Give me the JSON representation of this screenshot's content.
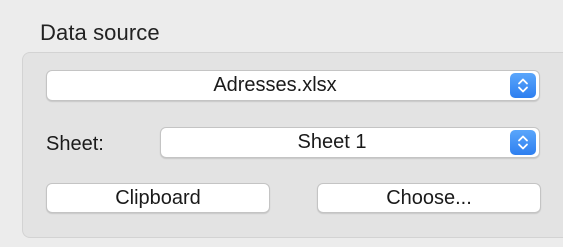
{
  "group": {
    "title": "Data source"
  },
  "file_popup": {
    "value": "Adresses.xlsx"
  },
  "sheet": {
    "label": "Sheet:",
    "value": "Sheet 1"
  },
  "buttons": {
    "clipboard_label": "Clipboard",
    "choose_label": "Choose..."
  },
  "colors": {
    "accent": "#3b8bf6",
    "panel": "#e3e3e3",
    "window": "#ececec"
  },
  "icons": {
    "popup_stepper": "chevron-up-down-icon"
  }
}
